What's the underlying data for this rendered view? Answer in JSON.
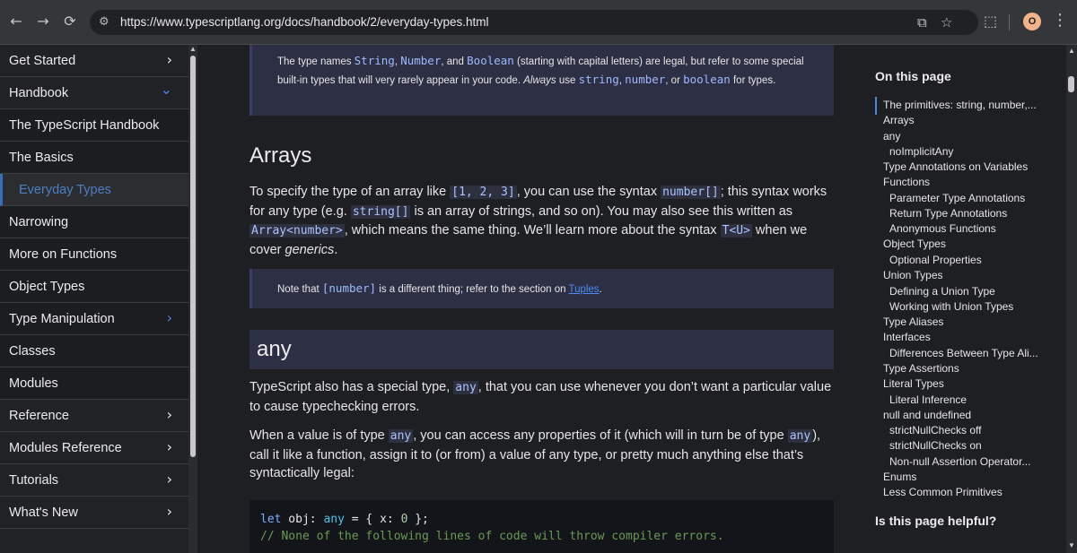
{
  "browser": {
    "back_icon": "←",
    "forward_icon": "→",
    "reload_icon": "⟳",
    "url": "https://www.typescriptlang.org/docs/handbook/2/everyday-types.html",
    "profile_initial": "O"
  },
  "sidebar": {
    "items": [
      {
        "label": "Get Started",
        "chevron": "›"
      },
      {
        "label": "Handbook",
        "chevron": "⌄"
      },
      {
        "label": "The TypeScript Handbook"
      },
      {
        "label": "The Basics"
      },
      {
        "label": "Everyday Types"
      },
      {
        "label": "Narrowing"
      },
      {
        "label": "More on Functions"
      },
      {
        "label": "Object Types"
      },
      {
        "label": "Type Manipulation",
        "chevron": "›"
      },
      {
        "label": "Classes"
      },
      {
        "label": "Modules"
      },
      {
        "label": "Reference",
        "chevron": "›"
      },
      {
        "label": "Modules Reference",
        "chevron": "›"
      },
      {
        "label": "Tutorials",
        "chevron": "›"
      },
      {
        "label": "What's New",
        "chevron": "›"
      }
    ]
  },
  "main": {
    "callout1": {
      "p1": "The type names ",
      "c1": "String",
      "p2": ", ",
      "c2": "Number",
      "p3": ", and ",
      "c3": "Boolean",
      "p4": " (starting with capital letters) are legal, but refer to some special built-in types that will very rarely appear in your code. ",
      "em": "Always",
      "p5": " use ",
      "c4": "string",
      "p6": ", ",
      "c5": "number",
      "p7": ", or ",
      "c6": "boolean",
      "p8": " for types."
    },
    "arrays_heading": "Arrays",
    "arrays_para": {
      "p1": "To specify the type of an array like ",
      "c1": "[1, 2, 3]",
      "p2": ", you can use the syntax ",
      "c2": "number[]",
      "p3": "; this syntax works for any type (e.g. ",
      "c3": "string[]",
      "p4": " is an array of strings, and so on). You may also see this written as ",
      "c4": "Array<number>",
      "p5": ", which means the same thing. We’ll learn more about the syntax ",
      "c5": "T<U>",
      "p6": " when we cover ",
      "em": "generics",
      "p7": "."
    },
    "callout2": {
      "p1": "Note that ",
      "c1": "[number]",
      "p2": " is a different thing; refer to the section on ",
      "link": "Tuples",
      "p3": "."
    },
    "any_heading": "any",
    "any_para1": {
      "p1": "TypeScript also has a special type, ",
      "c1": "any",
      "p2": ", that you can use whenever you don’t want a particular value to cause typechecking errors."
    },
    "any_para2": {
      "p1": "When a value is of type ",
      "c1": "any",
      "p2": ", you can access any properties of it (which will in turn be of type ",
      "c2": "any",
      "p3": "), call it like a function, assign it to (or from) a value of any type, or pretty much anything else that’s syntactically legal:"
    },
    "code": {
      "l1_kw": "let",
      "l1_var": " obj",
      "l1_colon": ": ",
      "l1_type": "any",
      "l1_eq": " = { x: ",
      "l1_num": "0",
      "l1_end": " };",
      "l2": "// None of the following lines of code will throw compiler errors."
    }
  },
  "toc": {
    "title": "On this page",
    "items": [
      "The primitives: string, number,...",
      "Arrays",
      "any",
      "noImplicitAny",
      "Type Annotations on Variables",
      "Functions",
      "Parameter Type Annotations",
      "Return Type Annotations",
      "Anonymous Functions",
      "Object Types",
      "Optional Properties",
      "Union Types",
      "Defining a Union Type",
      "Working with Union Types",
      "Type Aliases",
      "Interfaces",
      "Differences Between Type Ali...",
      "Type Assertions",
      "Literal Types",
      "Literal Inference",
      "null and undefined",
      "strictNullChecks off",
      "strictNullChecks on",
      "Non-null Assertion Operator...",
      "Enums",
      "Less Common Primitives"
    ],
    "helpful": "Is this page helpful?"
  }
}
